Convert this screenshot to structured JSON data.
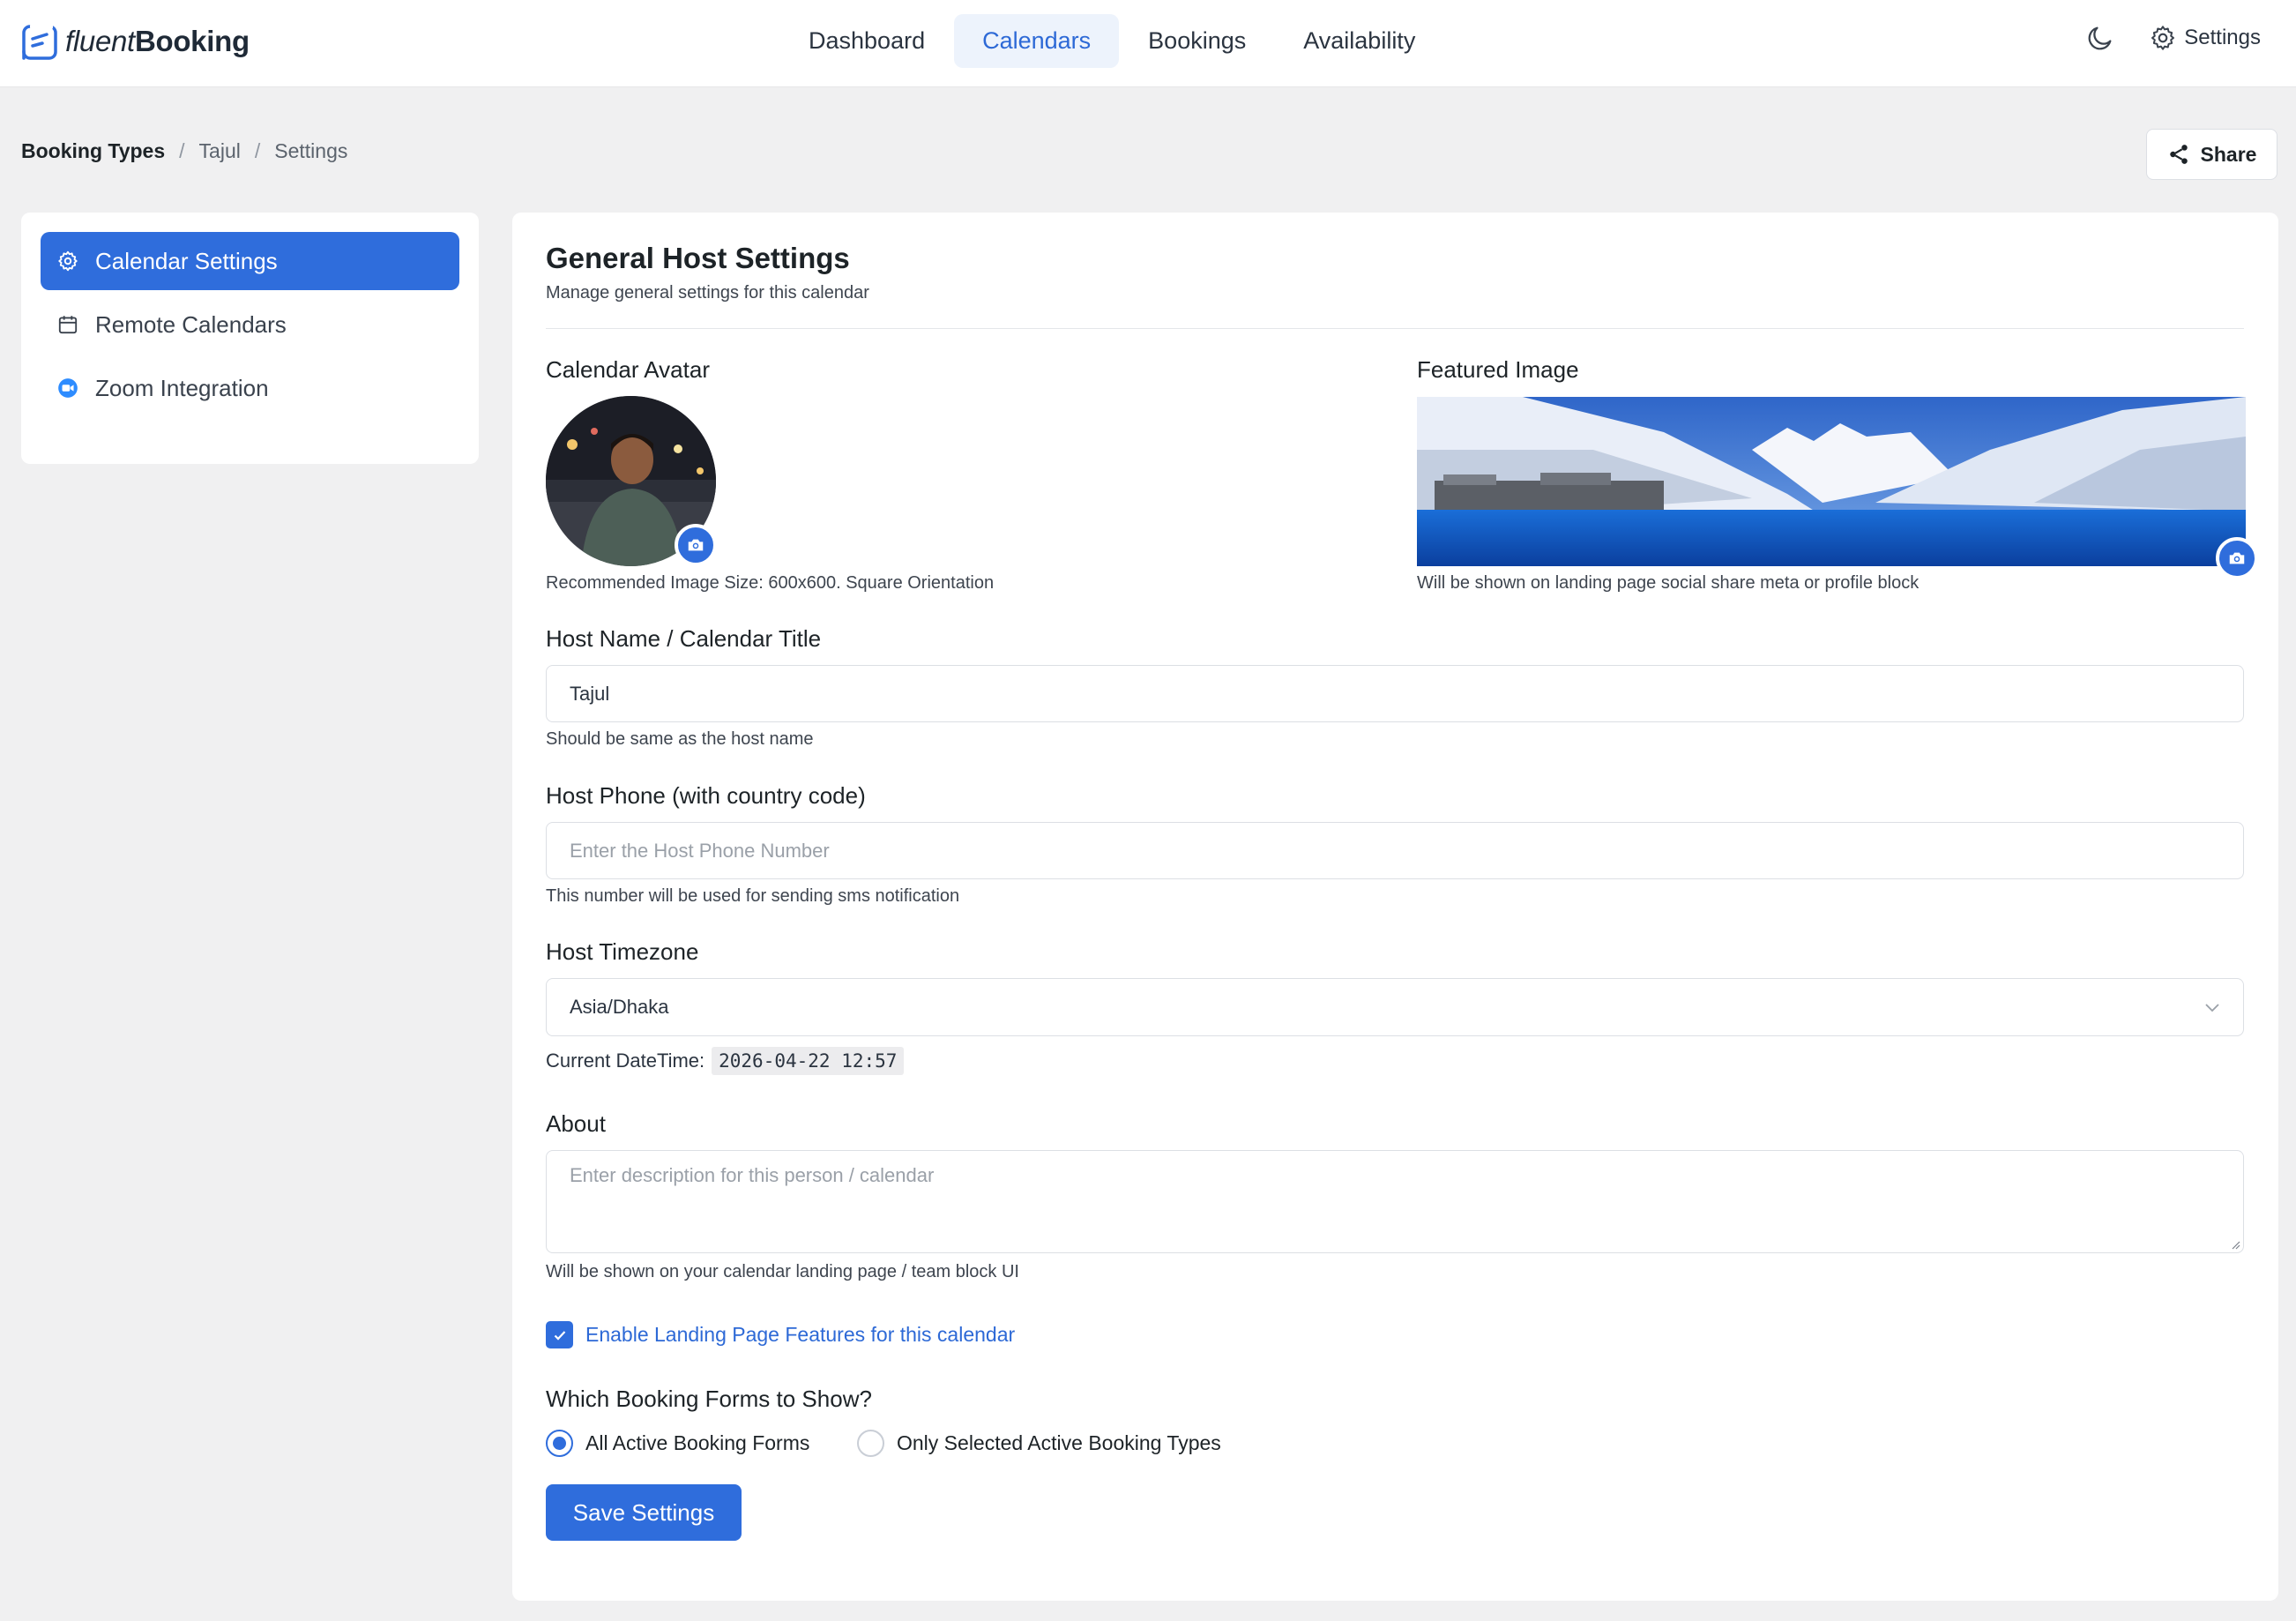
{
  "app": {
    "logo_light": "fluent",
    "logo_bold": "Booking",
    "nav": [
      {
        "label": "Dashboard"
      },
      {
        "label": "Calendars",
        "active": true
      },
      {
        "label": "Bookings"
      },
      {
        "label": "Availability"
      }
    ],
    "settings_label": "Settings"
  },
  "breadcrumb": {
    "items": [
      "Booking Types",
      "Tajul",
      "Settings"
    ],
    "separator": "/"
  },
  "share_label": "Share",
  "sidebar": {
    "items": [
      {
        "label": "Calendar Settings",
        "icon": "gear-icon",
        "active": true
      },
      {
        "label": "Remote Calendars",
        "icon": "calendar-icon"
      },
      {
        "label": "Zoom Integration",
        "icon": "zoom-icon"
      }
    ]
  },
  "form": {
    "title": "General Host Settings",
    "subtitle": "Manage general settings for this calendar",
    "avatar": {
      "label": "Calendar Avatar",
      "help": "Recommended Image Size: 600x600. Square Orientation"
    },
    "featured": {
      "label": "Featured Image",
      "help": "Will be shown on landing page social share meta or profile block"
    },
    "host_name": {
      "label": "Host Name / Calendar Title",
      "value": "Tajul",
      "help": "Should be same as the host name"
    },
    "host_phone": {
      "label": "Host Phone (with country code)",
      "placeholder": "Enter the Host Phone Number",
      "help": "This number will be used for sending sms notification"
    },
    "timezone": {
      "label": "Host Timezone",
      "value": "Asia/Dhaka",
      "current_label": "Current DateTime:",
      "current_value": "2026-04-22 12:57"
    },
    "about": {
      "label": "About",
      "placeholder": "Enter description for this person / calendar",
      "help": "Will be shown on your calendar landing page / team block UI"
    },
    "landing_checkbox": {
      "label": "Enable Landing Page Features for this calendar",
      "checked": true
    },
    "booking_forms": {
      "label": "Which Booking Forms to Show?",
      "options": [
        {
          "label": "All Active Booking Forms",
          "selected": true
        },
        {
          "label": "Only Selected Active Booking Types",
          "selected": false
        }
      ]
    },
    "save_label": "Save Settings"
  },
  "colors": {
    "primary": "#2f6ddc",
    "nav_active_bg": "#edf3fc",
    "page_bg": "#f0f0f1"
  }
}
